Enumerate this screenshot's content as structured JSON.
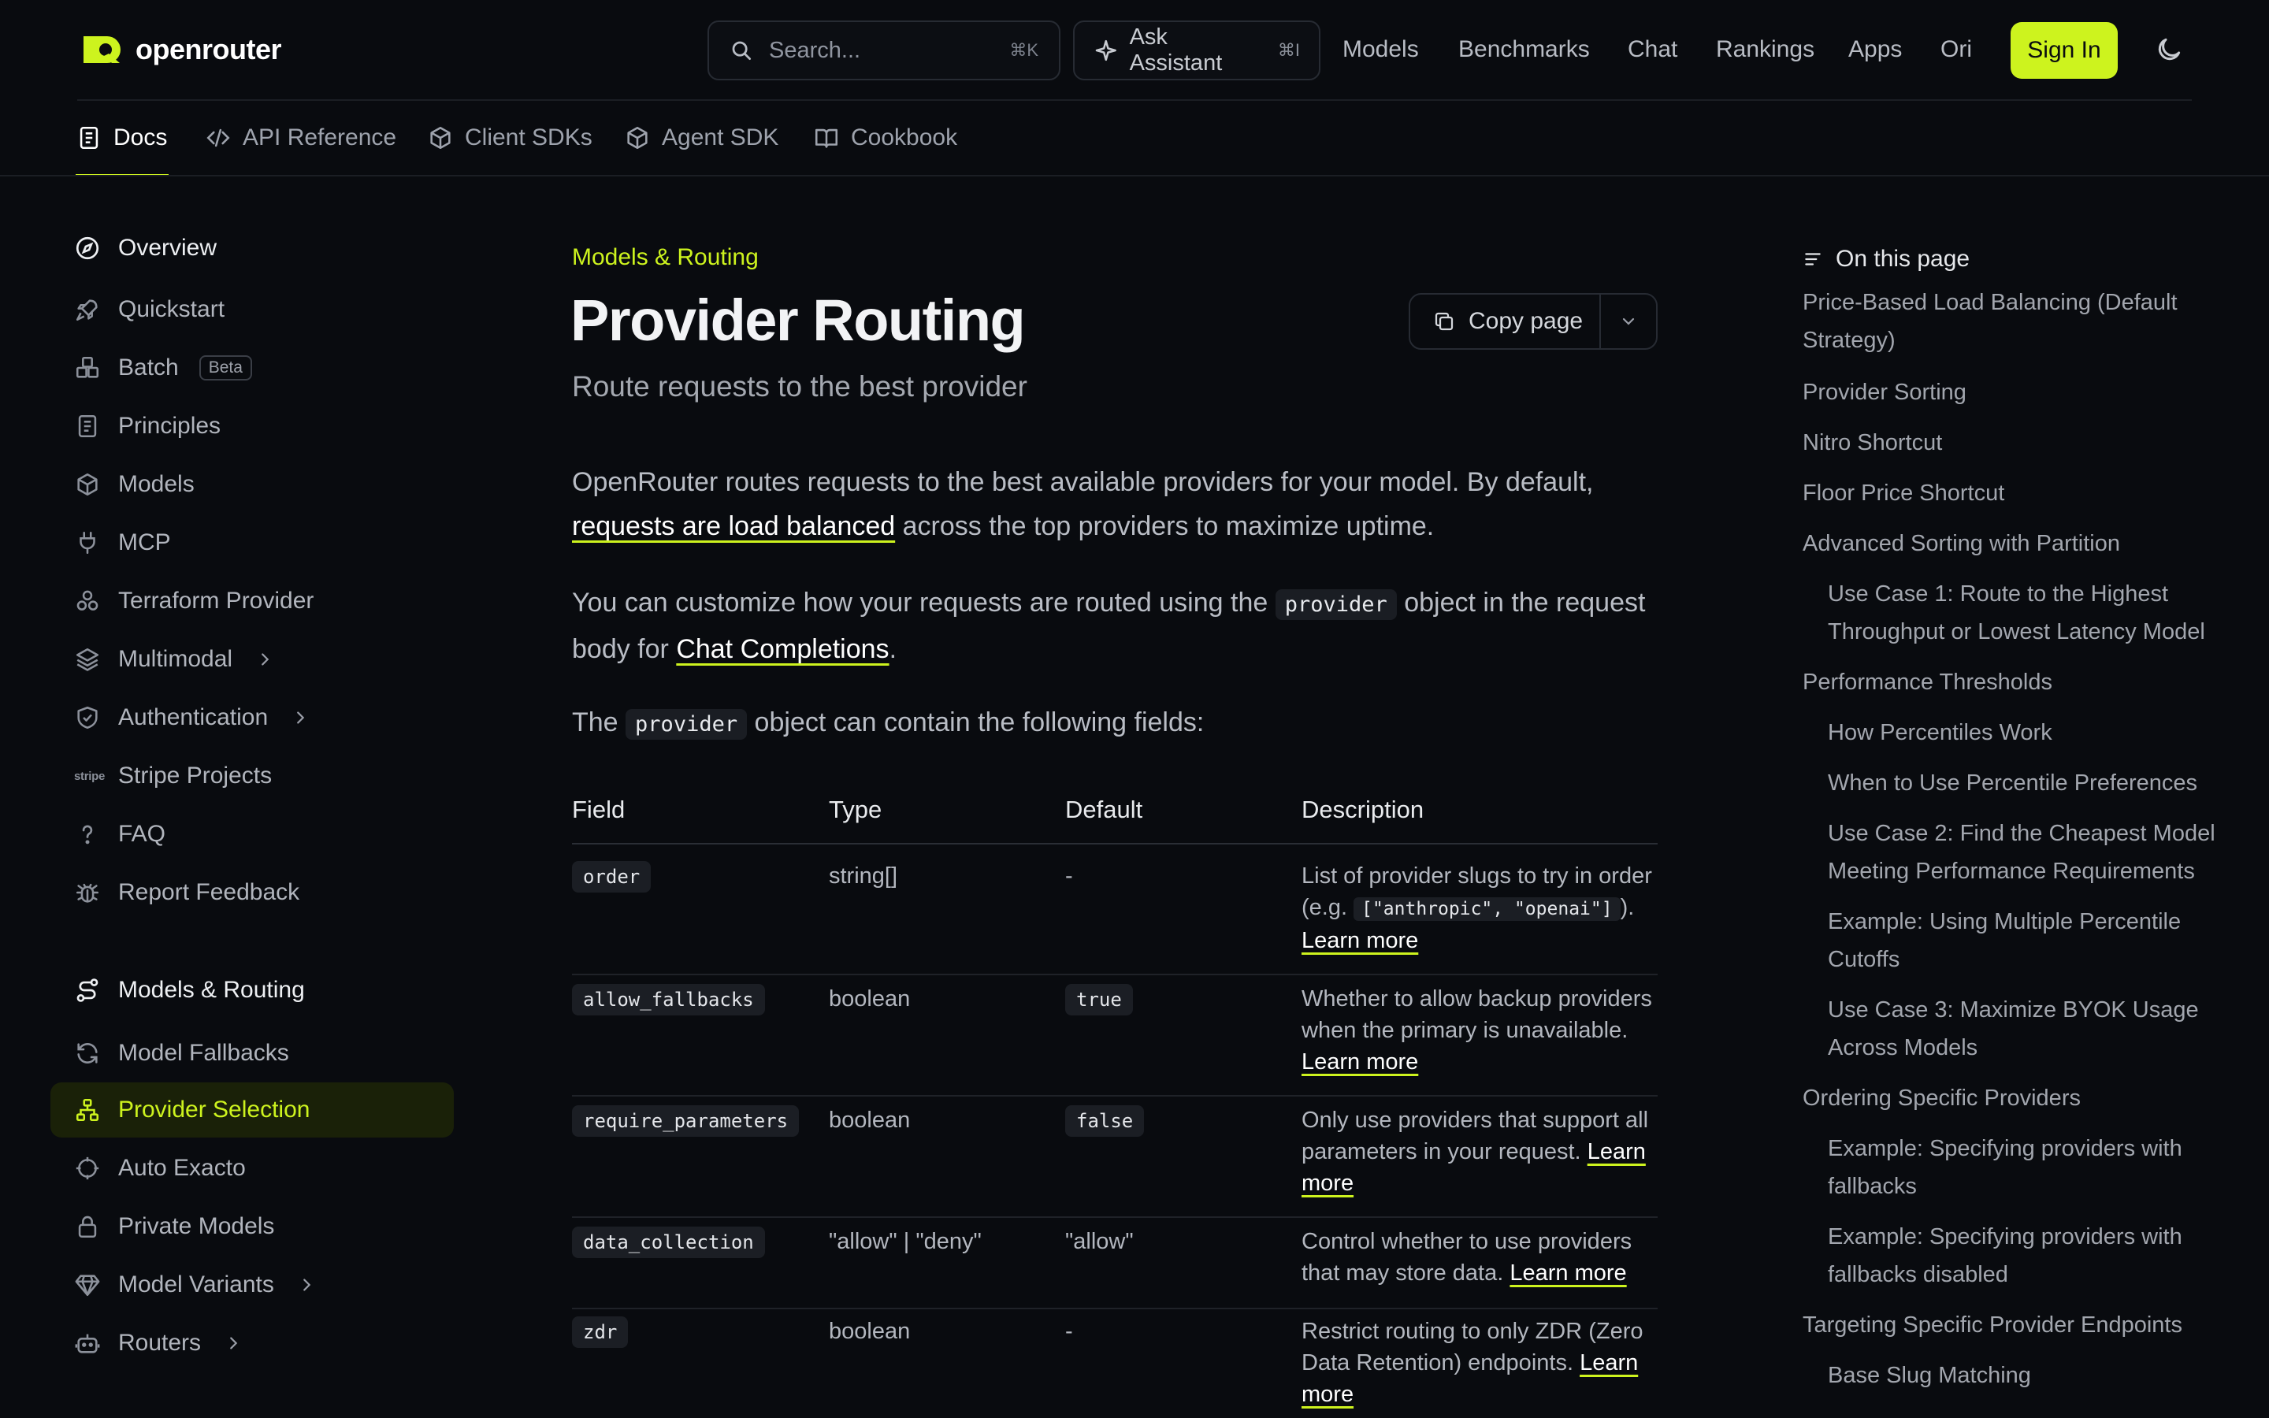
{
  "brand": {
    "name": "openrouter",
    "accent": "#cdf31e"
  },
  "header": {
    "search_placeholder": "Search...",
    "search_shortcut": "⌘K",
    "assistant_label": "Ask Assistant",
    "assistant_shortcut": "⌘I",
    "nav": [
      "Models",
      "Benchmarks",
      "Chat",
      "Rankings",
      "Apps",
      "Ori"
    ],
    "signin_label": "Sign In"
  },
  "tabs": [
    {
      "label": "Docs",
      "icon": "doc-icon",
      "active": true
    },
    {
      "label": "API Reference",
      "icon": "code-icon"
    },
    {
      "label": "Client SDKs",
      "icon": "cube-icon"
    },
    {
      "label": "Agent SDK",
      "icon": "cube-icon"
    },
    {
      "label": "Cookbook",
      "icon": "book-icon"
    }
  ],
  "sidebar": {
    "overview": "Overview",
    "group1": [
      {
        "label": "Quickstart",
        "icon": "rocket-icon"
      },
      {
        "label": "Batch",
        "icon": "boxes-icon",
        "badge": "Beta"
      },
      {
        "label": "Principles",
        "icon": "doc-icon"
      },
      {
        "label": "Models",
        "icon": "cube-icon"
      },
      {
        "label": "MCP",
        "icon": "plug-icon"
      },
      {
        "label": "Terraform Provider",
        "icon": "cluster-icon"
      },
      {
        "label": "Multimodal",
        "icon": "layers-icon",
        "chevron": true
      },
      {
        "label": "Authentication",
        "icon": "shield-check-icon",
        "chevron": true
      },
      {
        "label": "Stripe Projects",
        "icon": "stripe-icon",
        "icon_text": "stripe"
      },
      {
        "label": "FAQ",
        "icon": "question-icon"
      },
      {
        "label": "Report Feedback",
        "icon": "bug-icon"
      }
    ],
    "section2": "Models & Routing",
    "group2": [
      {
        "label": "Model Fallbacks",
        "icon": "refresh-icon"
      },
      {
        "label": "Provider Selection",
        "icon": "network-icon",
        "active": true
      },
      {
        "label": "Auto Exacto",
        "icon": "crosshair-icon"
      },
      {
        "label": "Private Models",
        "icon": "lock-icon"
      },
      {
        "label": "Model Variants",
        "icon": "gem-icon",
        "chevron": true
      },
      {
        "label": "Routers",
        "icon": "bot-icon",
        "chevron": true
      }
    ]
  },
  "main": {
    "breadcrumb": "Models & Routing",
    "title": "Provider Routing",
    "subtitle": "Route requests to the best provider",
    "copy_label": "Copy page",
    "p1_text": "OpenRouter routes requests to the best available providers for your model. By default,",
    "p1_link": "requests are load balanced",
    "p1_tail": "across the top providers to maximize uptime.",
    "p2_a": "You can customize how your requests are routed using the",
    "p2_code": "provider",
    "p2_b": "object in the request body for",
    "p2_link": "Chat Completions",
    "p2_end": ".",
    "p3_a": "The",
    "p3_code": "provider",
    "p3_b": "object can contain the following fields:",
    "table": {
      "headers": [
        "Field",
        "Type",
        "Default",
        "Description"
      ],
      "rows": [
        {
          "field": "order",
          "type": "string[]",
          "default": "-",
          "default_code": false,
          "desc": "List of provider slugs to try in order (e.g.",
          "desc_code": "[\"anthropic\", \"openai\"]",
          "desc_after": ").",
          "link": "Learn more"
        },
        {
          "field": "allow_fallbacks",
          "type": "boolean",
          "default": "true",
          "default_code": true,
          "desc": "Whether to allow backup providers when the primary is unavailable.",
          "link": "Learn more"
        },
        {
          "field": "require_parameters",
          "type": "boolean",
          "default": "false",
          "default_code": true,
          "desc": "Only use providers that support all parameters in your request.",
          "link": "Learn more"
        },
        {
          "field": "data_collection",
          "type": "\"allow\" | \"deny\"",
          "default": "\"allow\"",
          "default_code": false,
          "desc": "Control whether to use providers that may store data.",
          "link": "Learn more"
        },
        {
          "field": "zdr",
          "type": "boolean",
          "default": "-",
          "default_code": false,
          "desc": "Restrict routing to only ZDR (Zero Data Retention) endpoints.",
          "link": "Learn more"
        }
      ]
    }
  },
  "toc": {
    "title": "On this page",
    "items": [
      {
        "label": "Price-Based Load Balancing (Default Strategy)",
        "sub": false
      },
      {
        "label": "Provider Sorting",
        "sub": false
      },
      {
        "label": "Nitro Shortcut",
        "sub": false
      },
      {
        "label": "Floor Price Shortcut",
        "sub": false
      },
      {
        "label": "Advanced Sorting with Partition",
        "sub": false
      },
      {
        "label": "Use Case 1: Route to the Highest Throughput or Lowest Latency Model",
        "sub": true
      },
      {
        "label": "Performance Thresholds",
        "sub": false
      },
      {
        "label": "How Percentiles Work",
        "sub": true
      },
      {
        "label": "When to Use Percentile Preferences",
        "sub": true
      },
      {
        "label": "Use Case 2: Find the Cheapest Model Meeting Performance Requirements",
        "sub": true
      },
      {
        "label": "Example: Using Multiple Percentile Cutoffs",
        "sub": true
      },
      {
        "label": "Use Case 3: Maximize BYOK Usage Across Models",
        "sub": true
      },
      {
        "label": "Ordering Specific Providers",
        "sub": false
      },
      {
        "label": "Example: Specifying providers with fallbacks",
        "sub": true
      },
      {
        "label": "Example: Specifying providers with fallbacks disabled",
        "sub": true
      },
      {
        "label": "Targeting Specific Provider Endpoints",
        "sub": false
      },
      {
        "label": "Base Slug Matching",
        "sub": true
      }
    ]
  }
}
